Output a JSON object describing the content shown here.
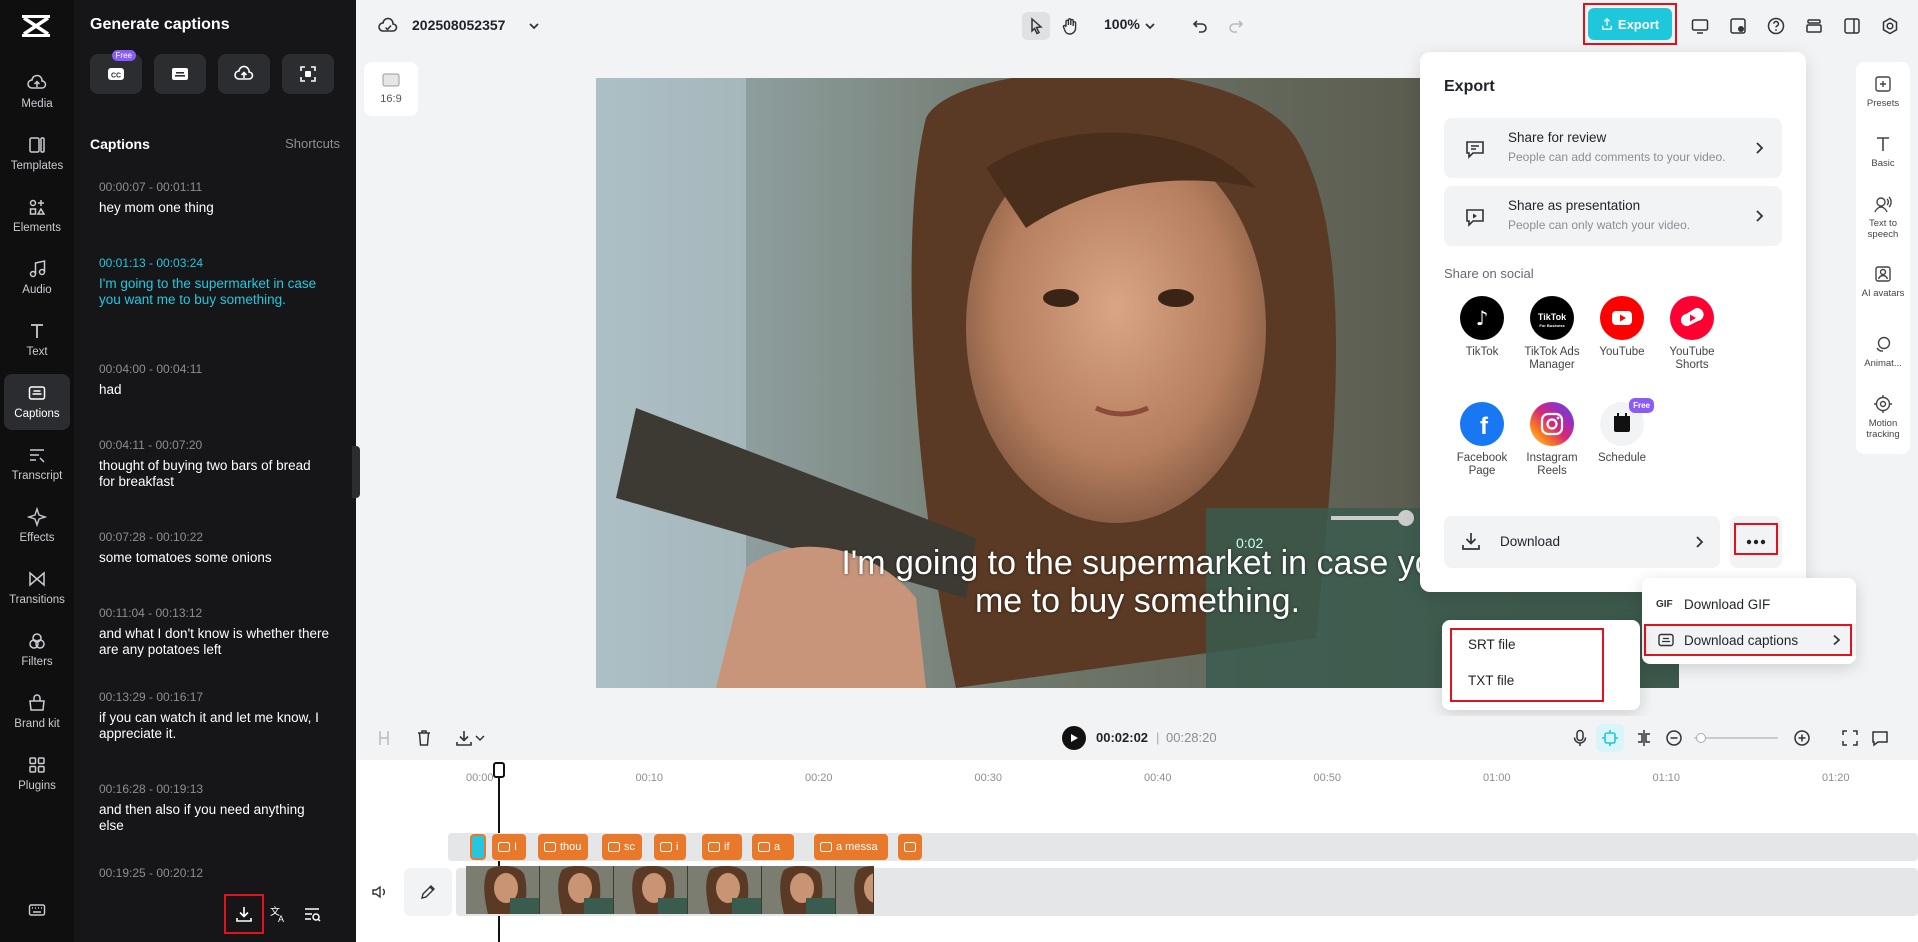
{
  "nav": {
    "items": [
      {
        "label": "Media",
        "icon": "cloud-upload-icon"
      },
      {
        "label": "Templates",
        "icon": "templates-icon"
      },
      {
        "label": "Elements",
        "icon": "elements-icon"
      },
      {
        "label": "Audio",
        "icon": "music-note-icon"
      },
      {
        "label": "Text",
        "icon": "text-icon"
      },
      {
        "label": "Captions",
        "icon": "captions-icon",
        "active": true
      },
      {
        "label": "Transcript",
        "icon": "transcript-icon"
      },
      {
        "label": "Effects",
        "icon": "sparkle-icon"
      },
      {
        "label": "Transitions",
        "icon": "transitions-icon"
      },
      {
        "label": "Filters",
        "icon": "filters-icon"
      },
      {
        "label": "Brand kit",
        "icon": "brand-kit-icon"
      },
      {
        "label": "Plugins",
        "icon": "plugins-icon"
      }
    ]
  },
  "panel": {
    "title": "Generate captions",
    "free_badge": "Free",
    "captions_heading": "Captions",
    "shortcuts": "Shortcuts",
    "captions": [
      {
        "time": "00:00:07 - 00:01:11",
        "text": "hey mom one thing"
      },
      {
        "time": "00:01:13 - 00:03:24",
        "text": "I'm going to the supermarket in case you want me to buy something.",
        "active": true
      },
      {
        "time": "00:04:00 - 00:04:11",
        "text": "had"
      },
      {
        "time": "00:04:11 - 00:07:20",
        "text": "thought of buying two bars of bread for breakfast"
      },
      {
        "time": "00:07:28 - 00:10:22",
        "text": "some tomatoes some onions"
      },
      {
        "time": "00:11:04 - 00:13:12",
        "text": "and what I don't know is whether there are any potatoes left"
      },
      {
        "time": "00:13:29 - 00:16:17",
        "text": "if you can watch it and let me know, I appreciate it."
      },
      {
        "time": "00:16:28 - 00:19:13",
        "text": "and then also if you need anything else"
      },
      {
        "time": "00:19:25 - 00:20:12",
        "text": ""
      }
    ]
  },
  "topbar": {
    "project_name": "202508052357",
    "zoom": "100%",
    "export_label": "Export"
  },
  "canvas": {
    "ratio": "16:9",
    "subtitle_line1": "I'm going to the supermarket in case yo",
    "subtitle_line2": "me to buy something.",
    "overlay_time": "0:02"
  },
  "right_tools": [
    {
      "label": "Presets",
      "icon": "presets-icon"
    },
    {
      "label": "Basic",
      "icon": "text-basic-icon"
    },
    {
      "label": "Text to speech",
      "icon": "text-to-speech-icon"
    },
    {
      "label": "AI avatars",
      "icon": "ai-avatar-icon"
    },
    {
      "label": "Animat...",
      "icon": "animation-icon"
    },
    {
      "label": "Motion tracking",
      "icon": "motion-tracking-icon"
    }
  ],
  "export_panel": {
    "title": "Export",
    "share_review": {
      "title": "Share for review",
      "sub": "People can add comments to your video."
    },
    "share_presentation": {
      "title": "Share as presentation",
      "sub": "People can only watch your video."
    },
    "social_heading": "Share on social",
    "socials": [
      {
        "label": "TikTok",
        "color": "#000000"
      },
      {
        "label": "TikTok Ads Manager",
        "color": "#000000"
      },
      {
        "label": "YouTube",
        "color": "#ff0000"
      },
      {
        "label": "YouTube Shorts",
        "color": "#ff0033"
      },
      {
        "label": "Facebook Page",
        "color": "#1877f2"
      },
      {
        "label": "Instagram Reels",
        "color": "#d62976"
      },
      {
        "label": "Schedule",
        "color": "#f2f3f5"
      }
    ],
    "free_badge": "Free",
    "download_label": "Download"
  },
  "more_menu": {
    "download_gif": "Download GIF",
    "gif_tag": "GIF",
    "download_captions": "Download captions"
  },
  "captions_submenu": {
    "srt": "SRT file",
    "txt": "TXT file"
  },
  "timeline": {
    "current_time": "00:02:02",
    "total_time": "00:28:20",
    "ruler": [
      "00:00",
      "00:10",
      "00:20",
      "00:30",
      "00:40",
      "00:50",
      "01:00",
      "01:10",
      "01:20"
    ],
    "caption_clips": [
      "I",
      "thou",
      "sc",
      "i",
      "if",
      "a",
      "a messa",
      ""
    ]
  },
  "colors": {
    "accent": "#1fc7da",
    "active_caption": "#23c8e0",
    "highlight_box": "#e0121e",
    "caption_clip": "#e8782a"
  }
}
